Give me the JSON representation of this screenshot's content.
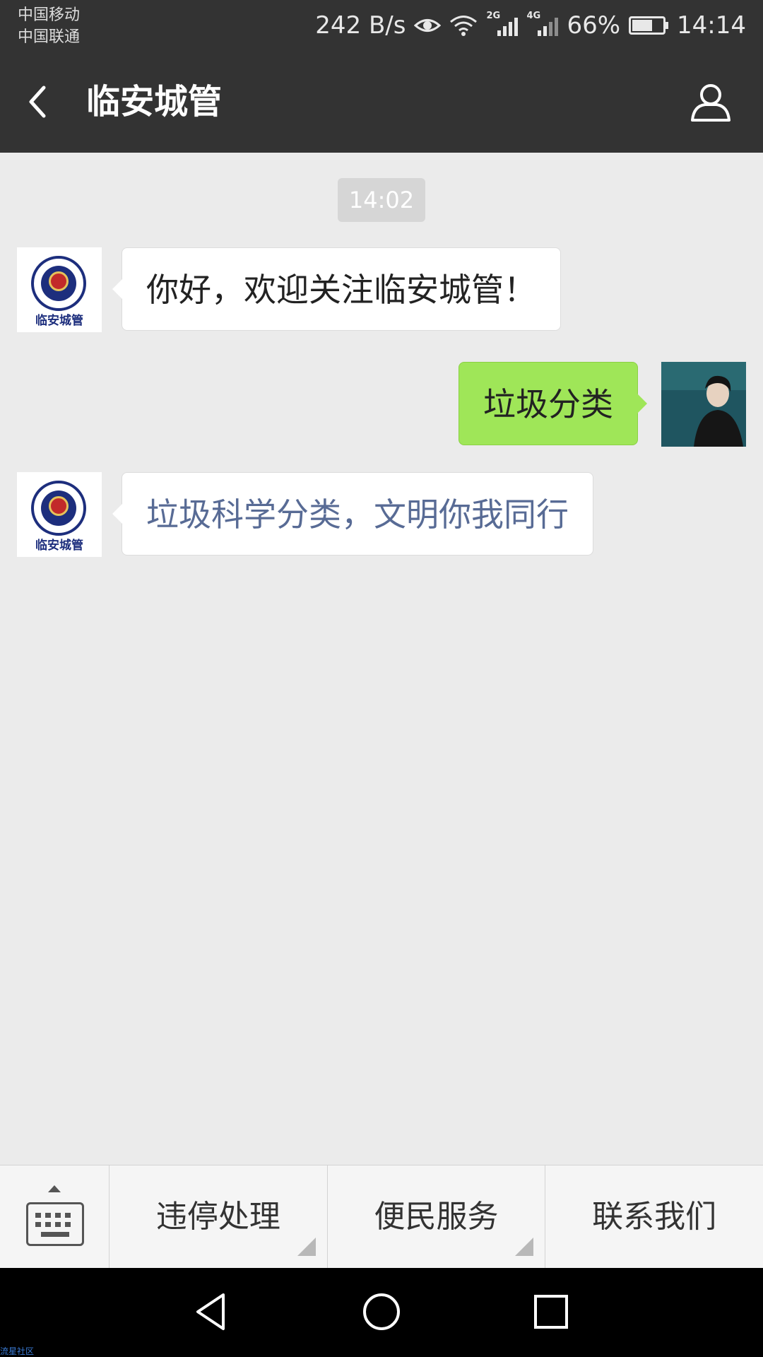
{
  "status_bar": {
    "carrier_1": "中国移动",
    "carrier_2": "中国联通",
    "net_speed": "242 B/s",
    "sig1_tag": "2G",
    "sig2_tag": "4G",
    "battery": "66%",
    "time": "14:14"
  },
  "header": {
    "title": "临安城管"
  },
  "chat": {
    "timestamp": "14:02",
    "messages": [
      {
        "from": "official",
        "text": "你好，欢迎关注临安城管！"
      },
      {
        "from": "user",
        "text": "垃圾分类"
      },
      {
        "from": "official",
        "text": "垃圾科学分类，文明你我同行"
      }
    ],
    "logo_text": "临安城管"
  },
  "menu": {
    "items": [
      {
        "label": "违停处理"
      },
      {
        "label": "便民服务"
      },
      {
        "label": "联系我们"
      }
    ]
  },
  "watermark": "流星社区",
  "colors": {
    "header_bg": "#333333",
    "chat_bg": "#ebebeb",
    "outgoing_bubble": "#9fe658",
    "link_text": "#586b95"
  }
}
